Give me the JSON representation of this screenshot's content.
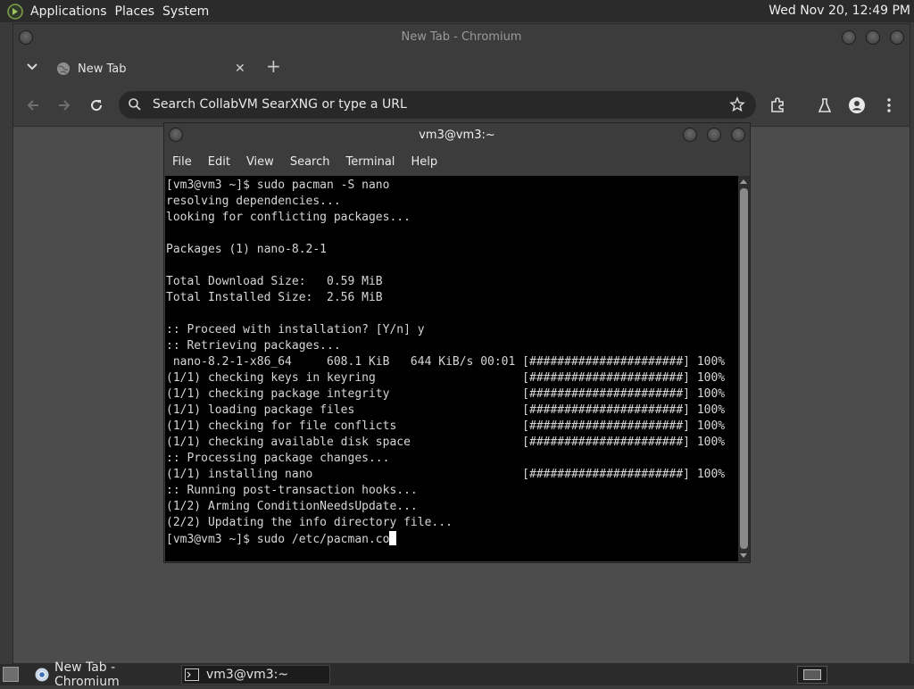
{
  "top_panel": {
    "menus": [
      "Applications",
      "Places",
      "System"
    ],
    "clock": "Wed Nov 20, 12:49 PM"
  },
  "chromium": {
    "window_title": "New Tab - Chromium",
    "tab": {
      "title": "New Tab"
    },
    "omnibox": {
      "placeholder": "Search CollabVM SearXNG or type a URL"
    }
  },
  "terminal": {
    "window_title": "vm3@vm3:~",
    "menus": [
      "File",
      "Edit",
      "View",
      "Search",
      "Terminal",
      "Help"
    ],
    "lines": [
      "[vm3@vm3 ~]$ sudo pacman -S nano",
      "resolving dependencies...",
      "looking for conflicting packages...",
      "",
      "Packages (1) nano-8.2-1",
      "",
      "Total Download Size:   0.59 MiB",
      "Total Installed Size:  2.56 MiB",
      "",
      ":: Proceed with installation? [Y/n] y",
      ":: Retrieving packages...",
      " nano-8.2-1-x86_64     608.1 KiB   644 KiB/s 00:01 [######################] 100%",
      "(1/1) checking keys in keyring                     [######################] 100%",
      "(1/1) checking package integrity                   [######################] 100%",
      "(1/1) loading package files                        [######################] 100%",
      "(1/1) checking for file conflicts                  [######################] 100%",
      "(1/1) checking available disk space                [######################] 100%",
      ":: Processing package changes...",
      "(1/1) installing nano                              [######################] 100%",
      ":: Running post-transaction hooks...",
      "(1/2) Arming ConditionNeedsUpdate...",
      "(2/2) Updating the info directory file..."
    ],
    "prompt_line": "[vm3@vm3 ~]$ sudo /etc/pacman.co"
  },
  "taskbar": {
    "items": [
      "New Tab - Chromium",
      "vm3@vm3:~"
    ]
  },
  "colors": {
    "panel_bg": "#2b2b2b",
    "terminal_bg": "#000000",
    "terminal_fg": "#d6d6d6"
  }
}
